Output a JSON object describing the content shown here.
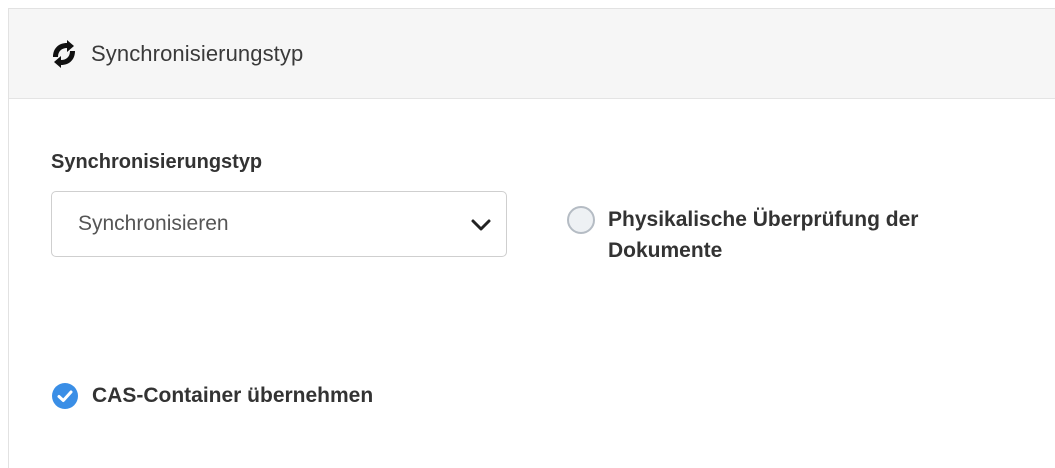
{
  "header": {
    "title": "Synchronisierungstyp",
    "icon": "sync-icon"
  },
  "form": {
    "sync_type_label": "Synchronisierungstyp",
    "sync_type_select": {
      "selected": "Synchronisieren"
    },
    "physical_check": {
      "label": "Physikalische Überprüfung der Dokumente",
      "checked": false
    },
    "cas_container": {
      "label": "CAS-Container übernehmen",
      "checked": true
    }
  },
  "colors": {
    "accent": "#3a8ee6",
    "header_bg": "#f6f6f6",
    "text": "#333333"
  }
}
